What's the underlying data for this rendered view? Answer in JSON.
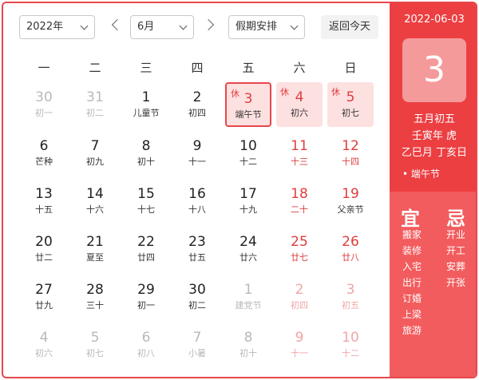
{
  "toolbar": {
    "year": "2022年",
    "month": "6月",
    "holiday_select": "假期安排",
    "today_button": "返回今天"
  },
  "weekdays": [
    "一",
    "二",
    "三",
    "四",
    "五",
    "六",
    "日"
  ],
  "weeks": [
    [
      {
        "d": "30",
        "l": "初一",
        "other": true
      },
      {
        "d": "31",
        "l": "初二",
        "other": true
      },
      {
        "d": "1",
        "l": "儿童节"
      },
      {
        "d": "2",
        "l": "初四"
      },
      {
        "d": "3",
        "l": "端午节",
        "holiday": true,
        "tag": "休",
        "selected": true
      },
      {
        "d": "4",
        "l": "初六",
        "holiday": true,
        "tag": "休"
      },
      {
        "d": "5",
        "l": "初七",
        "holiday": true,
        "tag": "休"
      }
    ],
    [
      {
        "d": "6",
        "l": "芒种"
      },
      {
        "d": "7",
        "l": "初九"
      },
      {
        "d": "8",
        "l": "初十"
      },
      {
        "d": "9",
        "l": "十一"
      },
      {
        "d": "10",
        "l": "十二"
      },
      {
        "d": "11",
        "l": "十三",
        "weekend": true
      },
      {
        "d": "12",
        "l": "十四",
        "weekend": true
      }
    ],
    [
      {
        "d": "13",
        "l": "十五"
      },
      {
        "d": "14",
        "l": "十六"
      },
      {
        "d": "15",
        "l": "十七"
      },
      {
        "d": "16",
        "l": "十八"
      },
      {
        "d": "17",
        "l": "十九"
      },
      {
        "d": "18",
        "l": "二十",
        "weekend": true
      },
      {
        "d": "19",
        "l": "父亲节",
        "weekend": true
      }
    ],
    [
      {
        "d": "20",
        "l": "廿二"
      },
      {
        "d": "21",
        "l": "夏至"
      },
      {
        "d": "22",
        "l": "廿四"
      },
      {
        "d": "23",
        "l": "廿五"
      },
      {
        "d": "24",
        "l": "廿六"
      },
      {
        "d": "25",
        "l": "廿七",
        "weekend": true
      },
      {
        "d": "26",
        "l": "廿八",
        "weekend": true
      }
    ],
    [
      {
        "d": "27",
        "l": "廿九"
      },
      {
        "d": "28",
        "l": "三十"
      },
      {
        "d": "29",
        "l": "初一"
      },
      {
        "d": "30",
        "l": "初二"
      },
      {
        "d": "1",
        "l": "建党节",
        "other": true
      },
      {
        "d": "2",
        "l": "初四",
        "other": true,
        "weekend": true
      },
      {
        "d": "3",
        "l": "初五",
        "other": true,
        "weekend": true
      }
    ],
    [
      {
        "d": "4",
        "l": "初六",
        "other": true
      },
      {
        "d": "5",
        "l": "初七",
        "other": true
      },
      {
        "d": "6",
        "l": "初八",
        "other": true
      },
      {
        "d": "7",
        "l": "小暑",
        "other": true
      },
      {
        "d": "8",
        "l": "初十",
        "other": true
      },
      {
        "d": "9",
        "l": "十一",
        "other": true,
        "weekend": true
      },
      {
        "d": "10",
        "l": "十二",
        "other": true,
        "weekend": true
      }
    ]
  ],
  "side": {
    "date": "2022-06-03",
    "day": "3",
    "lunar": "五月初五",
    "year_zodiac": "壬寅年 虎",
    "ganzhi": "乙巳月 丁亥日",
    "festival": "• 端午节",
    "yi_title": "宜",
    "ji_title": "忌",
    "yi": [
      "搬家",
      "装修",
      "入宅",
      "出行",
      "订婚",
      "上梁",
      "旅游"
    ],
    "ji": [
      "开业",
      "开工",
      "安葬",
      "开张"
    ]
  },
  "colors": {
    "accent": "#e8474b",
    "side_top": "#ec3f42",
    "side_bottom": "#f25c5e",
    "holiday_bg": "#fde0e0"
  }
}
